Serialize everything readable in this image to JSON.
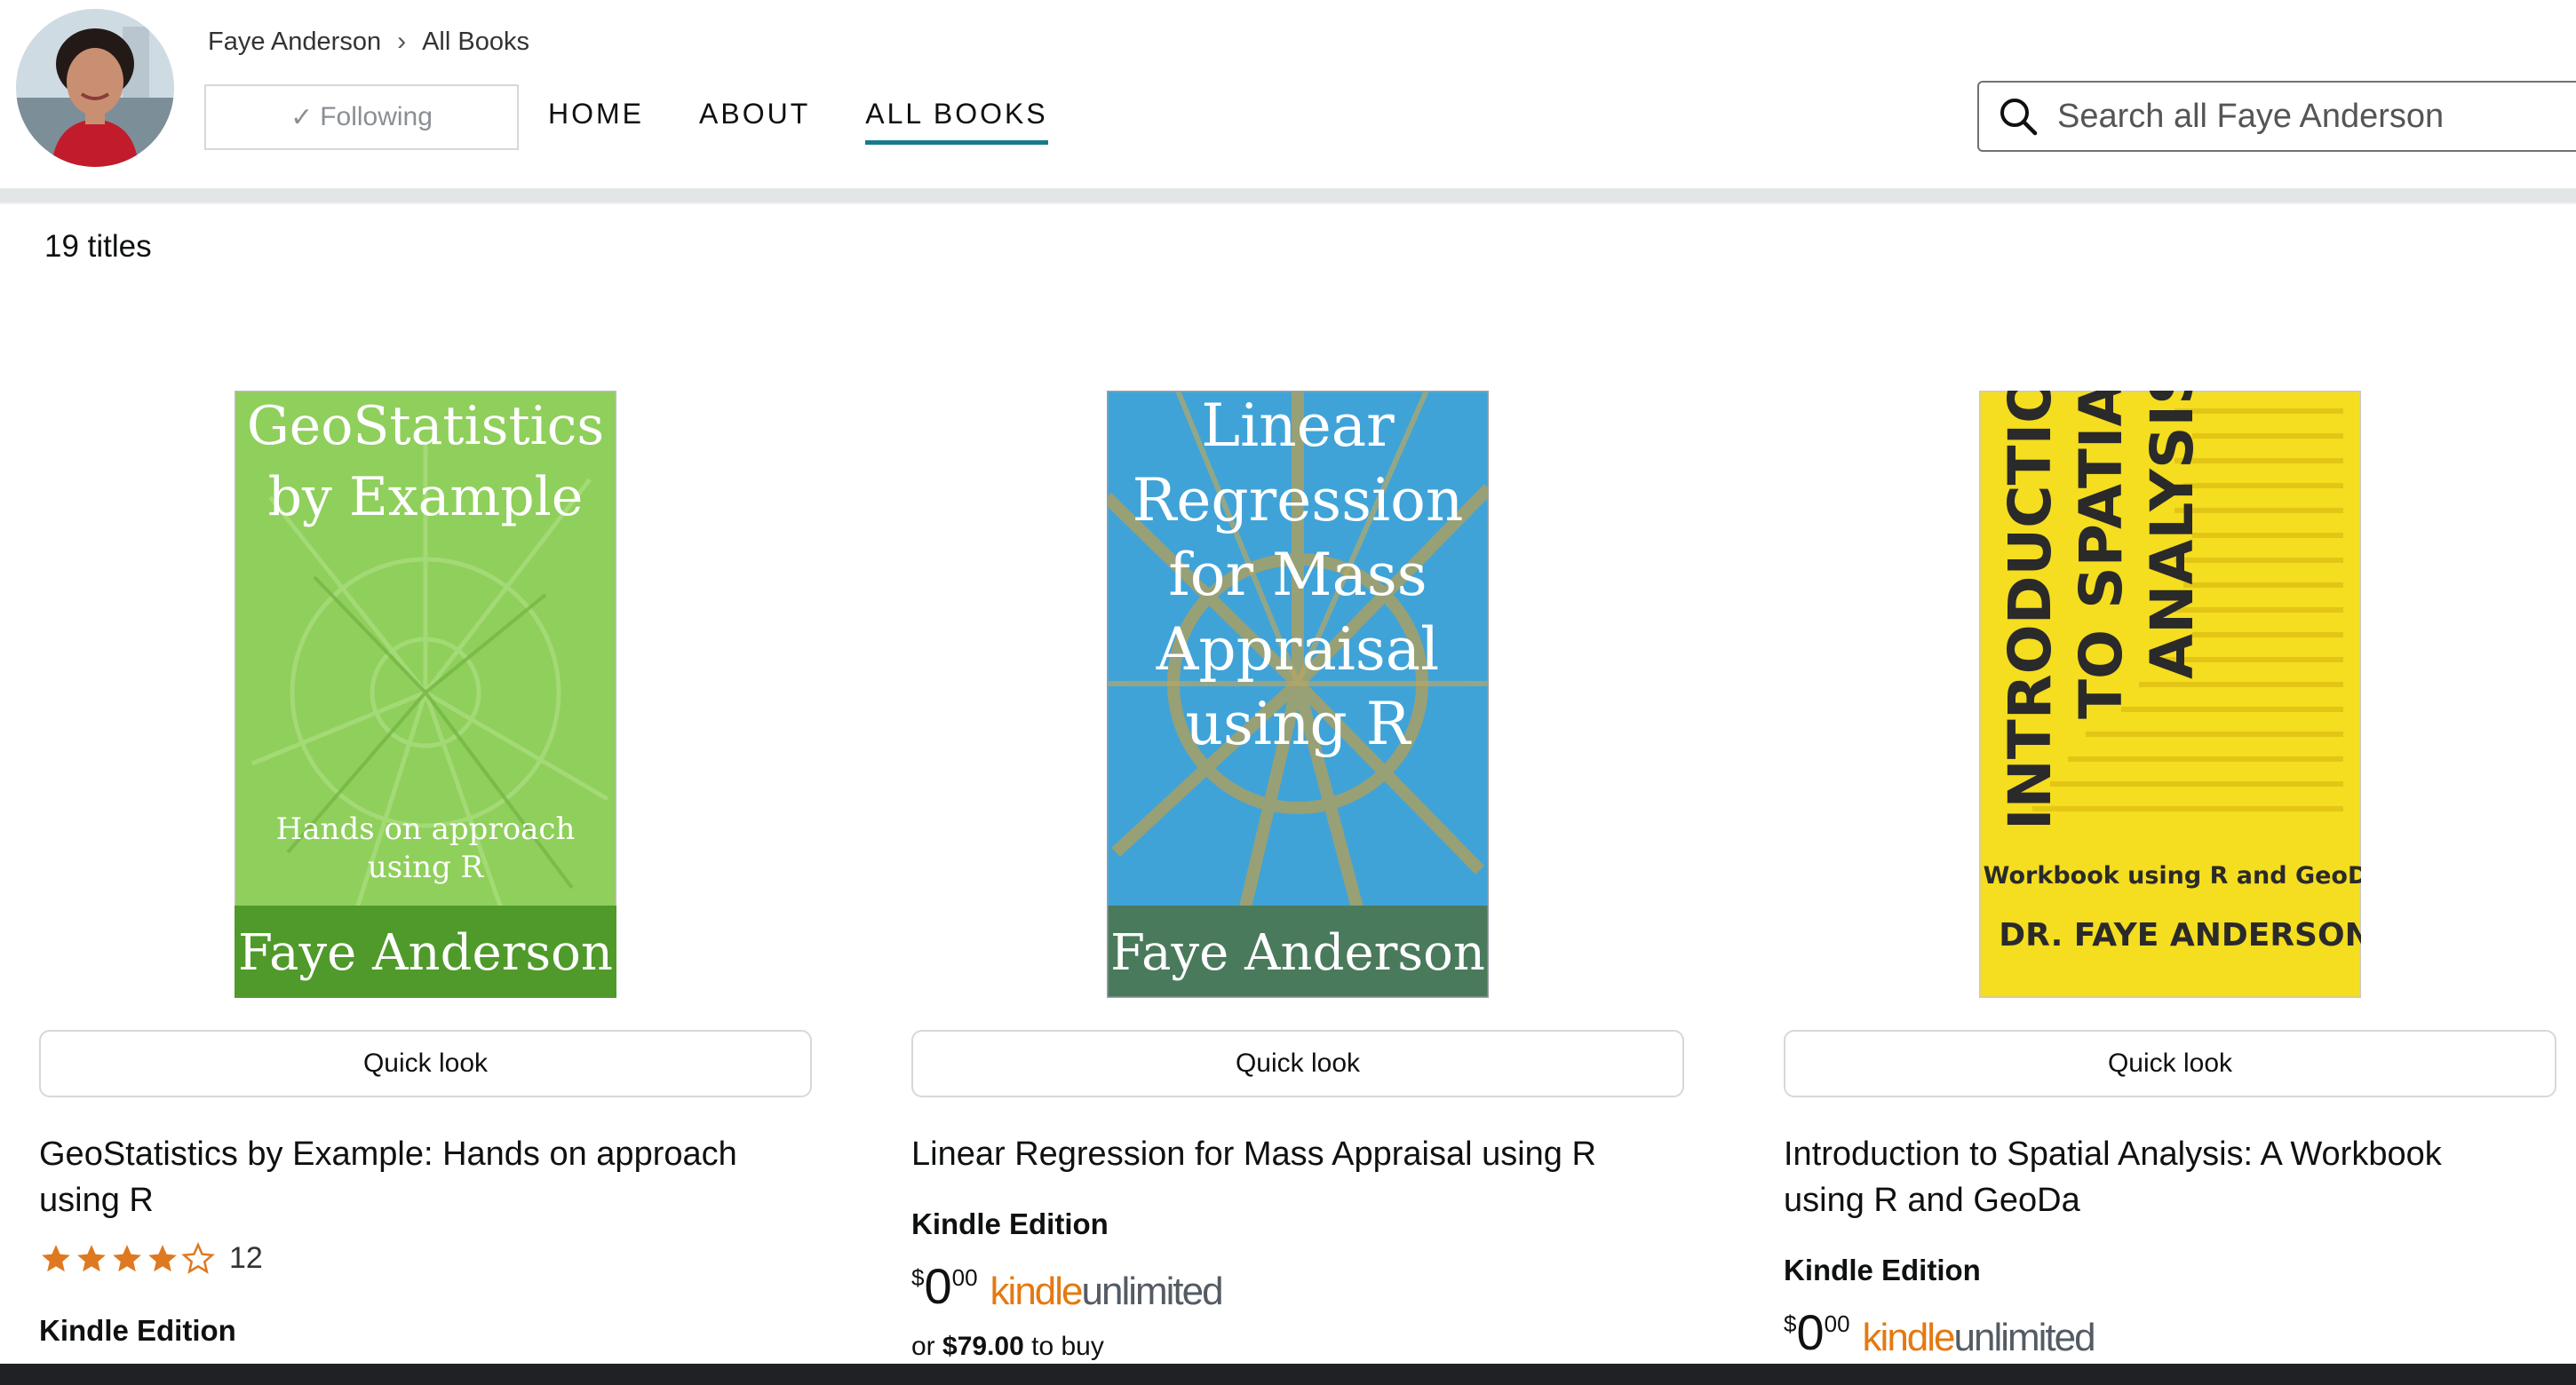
{
  "author": {
    "breadcrumb": [
      "Faye Anderson",
      "All Books"
    ],
    "follow_label": "Following"
  },
  "nav": [
    "HOME",
    "ABOUT",
    "ALL BOOKS"
  ],
  "nav_active": "ALL BOOKS",
  "search": {
    "placeholder": "Search all Faye Anderson"
  },
  "titles_count": "19 titles",
  "books": [
    {
      "cover_title_lines": [
        "GeoStatistics",
        "by Example"
      ],
      "cover_subtitle_lines": [
        "Hands on approach",
        "using R"
      ],
      "cover_author": "Faye Anderson",
      "quick_look": "Quick look",
      "title_lines": [
        "GeoStatistics by Example: Hands on approach",
        "using R"
      ],
      "rating": 4,
      "rating_count": "12",
      "format": "Kindle Edition"
    },
    {
      "cover_title_lines": [
        "Linear",
        "Regression",
        "for Mass",
        "Appraisal",
        "using R"
      ],
      "cover_author": "Faye Anderson",
      "quick_look": "Quick look",
      "title_lines": [
        "Linear Regression for Mass Appraisal using R"
      ],
      "format": "Kindle Edition",
      "price": {
        "symbol": "$",
        "whole": "0",
        "fraction": "00"
      },
      "kindle_unlimited": [
        "kindle",
        "unlimited"
      ],
      "buy": {
        "prefix": "or",
        "price": "$79.00",
        "suffix": "to buy"
      }
    },
    {
      "cover_title_lines": [
        "INTRODUCTION",
        "TO SPATIAL",
        "ANALYSIS"
      ],
      "cover_subtitle": "A Workbook using R and GeoDa",
      "cover_author": "DR. FAYE ANDERSON",
      "quick_look": "Quick look",
      "title_lines": [
        "Introduction to Spatial Analysis: A Workbook",
        "using R and GeoDa"
      ],
      "format": "Kindle Edition",
      "price": {
        "symbol": "$",
        "whole": "0",
        "fraction": "00"
      },
      "kindle_unlimited": [
        "kindle",
        "unlimited"
      ]
    }
  ],
  "colors": {
    "accent": "#197a8c",
    "ku_orange": "#e47911",
    "star": "#de7921"
  }
}
